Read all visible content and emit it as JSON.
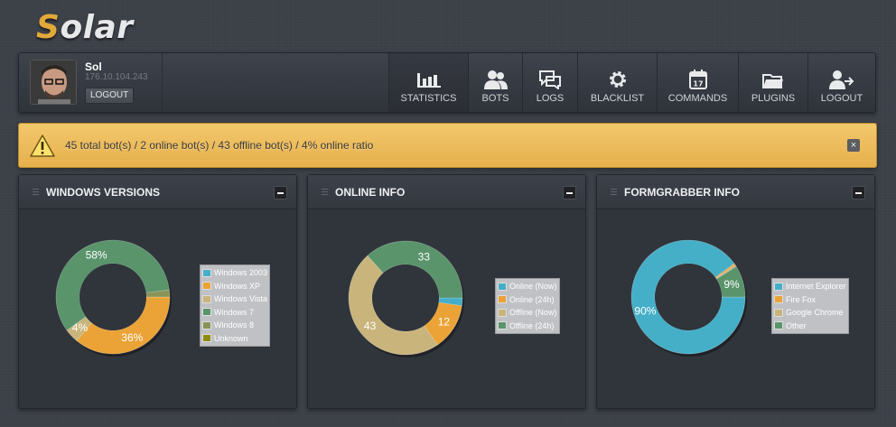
{
  "app": {
    "logo_first": "S",
    "logo_rest": "olar"
  },
  "user": {
    "name": "Sol",
    "ip": "176.10.104.243",
    "logout_label": "LOGOUT"
  },
  "nav": [
    {
      "label": "STATISTICS",
      "icon": "bar-chart-icon",
      "active": true
    },
    {
      "label": "BOTS",
      "icon": "users-icon",
      "active": false
    },
    {
      "label": "LOGS",
      "icon": "chat-bubbles-icon",
      "active": false
    },
    {
      "label": "BLACKLIST",
      "icon": "gear-icon",
      "active": false
    },
    {
      "label": "COMMANDS",
      "icon": "calendar-icon",
      "active": false,
      "badge": "17"
    },
    {
      "label": "PLUGINS",
      "icon": "folder-icon",
      "active": false
    },
    {
      "label": "LOGOUT",
      "icon": "user-logout-icon",
      "active": false
    }
  ],
  "alert": {
    "text": "45 total bot(s) / 2 online bot(s) / 43 offline bot(s) / 4% online ratio",
    "close_label": "×",
    "color": "#efbe5d"
  },
  "panels": [
    {
      "title": "WINDOWS VERSIONS",
      "chart_data": {
        "type": "pie",
        "categories": [
          "Windows 2003",
          "Windows XP",
          "Windows Vista",
          "Windows 7",
          "Windows 8",
          "Unknown"
        ],
        "values": [
          0,
          36,
          4,
          58,
          2,
          0
        ],
        "labels": [
          "",
          "36%",
          "4%",
          "58%",
          "",
          ""
        ],
        "colors": [
          "#45afc8",
          "#eba337",
          "#c9b47c",
          "#5a946b",
          "#899557",
          "#8d8c11"
        ]
      }
    },
    {
      "title": "ONLINE INFO",
      "chart_data": {
        "type": "pie",
        "categories": [
          "Online (Now)",
          "Online (24h)",
          "Offline (Now)",
          "Offline (24h)"
        ],
        "values": [
          2,
          12,
          43,
          33
        ],
        "labels": [
          "",
          "12",
          "43",
          "33"
        ],
        "colors": [
          "#45afc8",
          "#eba337",
          "#c9b47c",
          "#5a946b"
        ]
      }
    },
    {
      "title": "FORMGRABBER INFO",
      "chart_data": {
        "type": "pie",
        "categories": [
          "Internet Explorer",
          "Fire Fox",
          "Google Chrome",
          "Other"
        ],
        "values": [
          90,
          0.5,
          0.5,
          9
        ],
        "labels": [
          "90%",
          "",
          "",
          "9%"
        ],
        "colors": [
          "#45afc8",
          "#eba337",
          "#c9b47c",
          "#5a946b"
        ]
      }
    }
  ]
}
